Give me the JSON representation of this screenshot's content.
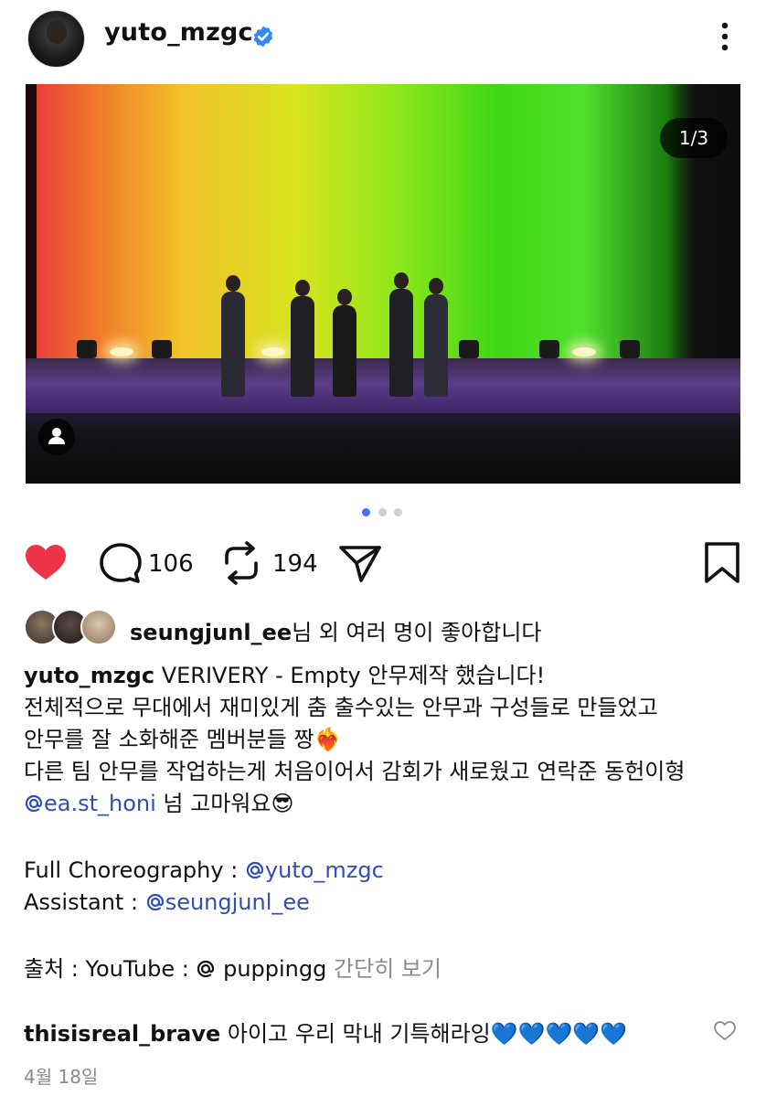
{
  "post": {
    "author": "yuto_mzgc",
    "verified": true,
    "media": {
      "counter": "1/3",
      "dots_total": 3,
      "dots_active": 1,
      "active_dot_color": "#4a6cf7"
    },
    "actions": {
      "liked": true,
      "like_color": "#ed3347",
      "comments": "106",
      "reposts": "194"
    },
    "likes": {
      "user": "seungjunl_ee",
      "suffix": "님 외 여러 명이 좋아합니다"
    },
    "caption": {
      "author": "yuto_mzgc",
      "line1": " VERIVERY - Empty 안무제작 했습니다!",
      "line2": "전체적으로 무대에서 재미있게 춤 출수있는 안무과 구성들로 만들었고",
      "line3": "안무를 잘 소화해준 멤버분들 짱",
      "line3_emoji": "❤️‍🔥",
      "line4": "다른 팀 안무를 작업하는게 처음이어서 감회가 새로웠고 연락준 동헌이형",
      "line5_mention": "ea.st_honi",
      "line5_text": " 넘 고마워요",
      "line5_emoji": "😎",
      "full_label": "Full Choreography : ",
      "full_mention": "yuto_mzgc",
      "assistant_label": "Assistant : ",
      "assistant_mention": "seungjunl_ee",
      "source_label": "출처 : YouTube : ",
      "source_mention": "puppingg",
      "more_label": " 간단히 보기"
    },
    "comment": {
      "author": "thisisreal_brave",
      "text": " 아이고 우리 막내 기특해라잉",
      "hearts": "💙💙💙💙💙"
    },
    "date": "4월 18일"
  }
}
